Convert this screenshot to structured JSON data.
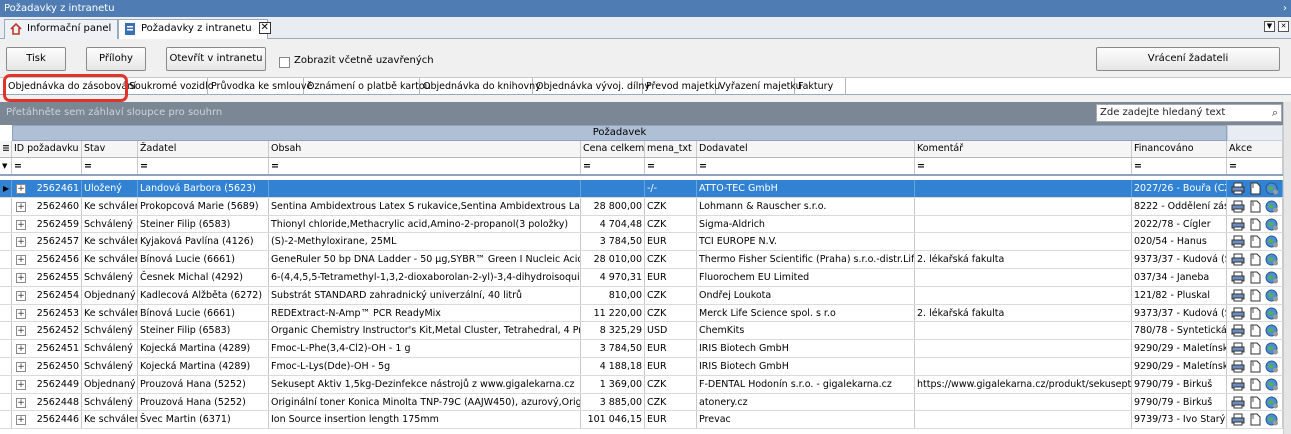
{
  "window": {
    "title": "Požadavky z intranetu"
  },
  "doc_tabs": [
    {
      "label": "Informační panel",
      "icon": "home-icon"
    },
    {
      "label": "Požadavky z intranetu",
      "icon": "document-icon",
      "close": "✕"
    }
  ],
  "toolbar": {
    "print_label": "Tisk",
    "attachments_label": "Přílohy",
    "open_intranet_label": "Otevřít v intranetu",
    "include_closed_label": "Zobrazit včetně uzavřených",
    "return_label": "Vrácení žadateli"
  },
  "category_tabs": [
    "Objednávka do zásobování",
    "Soukromé vozidlo",
    "Průvodka ke smlouvě",
    "Oznámení o platbě kartou",
    "Objednávka do knihovny",
    "Objednávka vývoj. dílny",
    "Převod majetku",
    "Vyřazení majetku",
    "Faktury"
  ],
  "grid": {
    "group_hint": "Přetáhněte sem záhlaví sloupce pro souhrn",
    "search_placeholder": "Zde zadejte hledaný text",
    "band_label": "Požadavek",
    "filter_symbol": "=",
    "columns": [
      "ID požadavku",
      "Stav",
      "Žadatel",
      "Obsah",
      "Cena celkem",
      "mena_txt",
      "Dodavatel",
      "Komentář",
      "Financováno",
      "Akce"
    ],
    "rows": [
      {
        "id": "2562461",
        "stav": "Uložený",
        "zadatel": "Landová Barbora (5623)",
        "obsah": "",
        "cena": "",
        "mena": "-/-",
        "dodavatel": "ATTO-TEC GmbH",
        "komentar": "",
        "financovano": "2027/26 - Bouřa (CZ.0",
        "selected": true
      },
      {
        "id": "2562460",
        "stav": "Ke schválení",
        "zadatel": "Prokopcová Marie (5689)",
        "obsah": "Sentina Ambidextrous Latex S rukavice,Sentina Ambidextrous Latex M ruk",
        "cena": "28 800,00",
        "mena": "CZK",
        "dodavatel": "Lohmann & Rauscher s.r.o.",
        "komentar": "",
        "financovano": "8222 - Oddělení zásob"
      },
      {
        "id": "2562459",
        "stav": "Schválený",
        "zadatel": "Steiner Filip (6583)",
        "obsah": "Thionyl chloride,Methacrylic acid,Amino-2-propanol(3 položky)",
        "cena": "4 704,48",
        "mena": "CZK",
        "dodavatel": "Sigma-Aldrich",
        "komentar": "",
        "financovano": "2022/78 - Cígler"
      },
      {
        "id": "2562457",
        "stav": "Ke schválení",
        "zadatel": "Kyjaková Pavlína (4126)",
        "obsah": "(S)-2-Methyloxirane, 25ML",
        "cena": "3 784,50",
        "mena": "EUR",
        "dodavatel": "TCI EUROPE N.V.",
        "komentar": "",
        "financovano": "020/54 - Hanus"
      },
      {
        "id": "2562456",
        "stav": "Ke schválení",
        "zadatel": "Bínová Lucie (6661)",
        "obsah": "GeneRuler 50 bp DNA Ladder - 50 µg,SYBR™ Green I Nucleic Acid Gel Stai",
        "cena": "28 010,00",
        "mena": "CZK",
        "dodavatel": "Thermo Fisher Scientific (Praha) s.r.o.-distr.Life",
        "komentar": "2. lékařská fakulta",
        "financovano": "9373/37 - Kudová (Sp"
      },
      {
        "id": "2562455",
        "stav": "Schválený",
        "zadatel": "Česnek Michal (4292)",
        "obsah": "6-(4,4,5,5-Tetramethyl-1,3,2-dioxaborolan-2-yl)-3,4-dihydroisoquinolin-1",
        "cena": "4 970,31",
        "mena": "EUR",
        "dodavatel": "Fluorochem EU Limited",
        "komentar": "",
        "financovano": "037/34 - Janeba"
      },
      {
        "id": "2562454",
        "stav": "Objednaný",
        "zadatel": "Kadlecová Alžběta (6272)",
        "obsah": "Substrát STANDARD zahradnický univerzální, 40 litrů",
        "cena": "810,00",
        "mena": "CZK",
        "dodavatel": "Ondřej Loukota",
        "komentar": "",
        "financovano": "121/82 - Pluskal"
      },
      {
        "id": "2562453",
        "stav": "Ke schválení",
        "zadatel": "Bínová Lucie (6661)",
        "obsah": "REDExtract-N-Amp™ PCR ReadyMix",
        "cena": "11 220,00",
        "mena": "CZK",
        "dodavatel": "Merck Life Science spol. s r.o",
        "komentar": "2. lékařská fakulta",
        "financovano": "9373/37 - Kudová (Sp"
      },
      {
        "id": "2562452",
        "stav": "Schválený",
        "zadatel": "Steiner Filip (6583)",
        "obsah": "Organic Chemistry Instructor's Kit,Metal Cluster, Tetrahedral, 4 Prong, Ba",
        "cena": "8 325,29",
        "mena": "USD",
        "dodavatel": "ChemKits",
        "komentar": "",
        "financovano": "780/78 - Syntetická n"
      },
      {
        "id": "2562451",
        "stav": "Schválený",
        "zadatel": "Kojecká Martina (4289)",
        "obsah": "Fmoc-L-Phe(3,4-Cl2)-OH - 1 g",
        "cena": "3 784,50",
        "mena": "EUR",
        "dodavatel": "IRIS Biotech GmbH",
        "komentar": "",
        "financovano": "9290/29 - Maletínská"
      },
      {
        "id": "2562450",
        "stav": "Schválený",
        "zadatel": "Kojecká Martina (4289)",
        "obsah": "Fmoc-L-Lys(Dde)-OH - 5g",
        "cena": "4 188,18",
        "mena": "EUR",
        "dodavatel": "IRIS Biotech GmbH",
        "komentar": "",
        "financovano": "9290/29 - Maletínská"
      },
      {
        "id": "2562449",
        "stav": "Objednaný",
        "zadatel": "Prouzová Hana (5252)",
        "obsah": "Sekusept Aktiv 1,5kg-Dezinfekce nástrojů z www.gigalekarna.cz",
        "cena": "1 369,00",
        "mena": "CZK",
        "dodavatel": "F-DENTAL Hodonín s.r.o. - gigalekarna.cz",
        "komentar": "https://www.gigalekarna.cz/produkt/sekusept-akti",
        "financovano": "9790/79 - Birkuš"
      },
      {
        "id": "2562448",
        "stav": "Schválený",
        "zadatel": "Prouzová Hana (5252)",
        "obsah": "  Originální toner Konica Minolta TNP-79C (AAJW450), azurový,Originální t",
        "cena": "3 885,00",
        "mena": "CZK",
        "dodavatel": "atonery.cz",
        "komentar": "",
        "financovano": "9790/79 - Birkuš"
      },
      {
        "id": "2562446",
        "stav": "Ke schválení",
        "zadatel": "Švec Martin (6371)",
        "obsah": "Ion Source insertion length 175mm",
        "cena": "101 046,15",
        "mena": "EUR",
        "dodavatel": "Prevac",
        "komentar": "",
        "financovano": "9739/73 - Ivo Starý ("
      }
    ]
  },
  "colors": {
    "selected_row": "#3182d2",
    "highlight": "#e0342b",
    "band": "#aebfd6"
  }
}
